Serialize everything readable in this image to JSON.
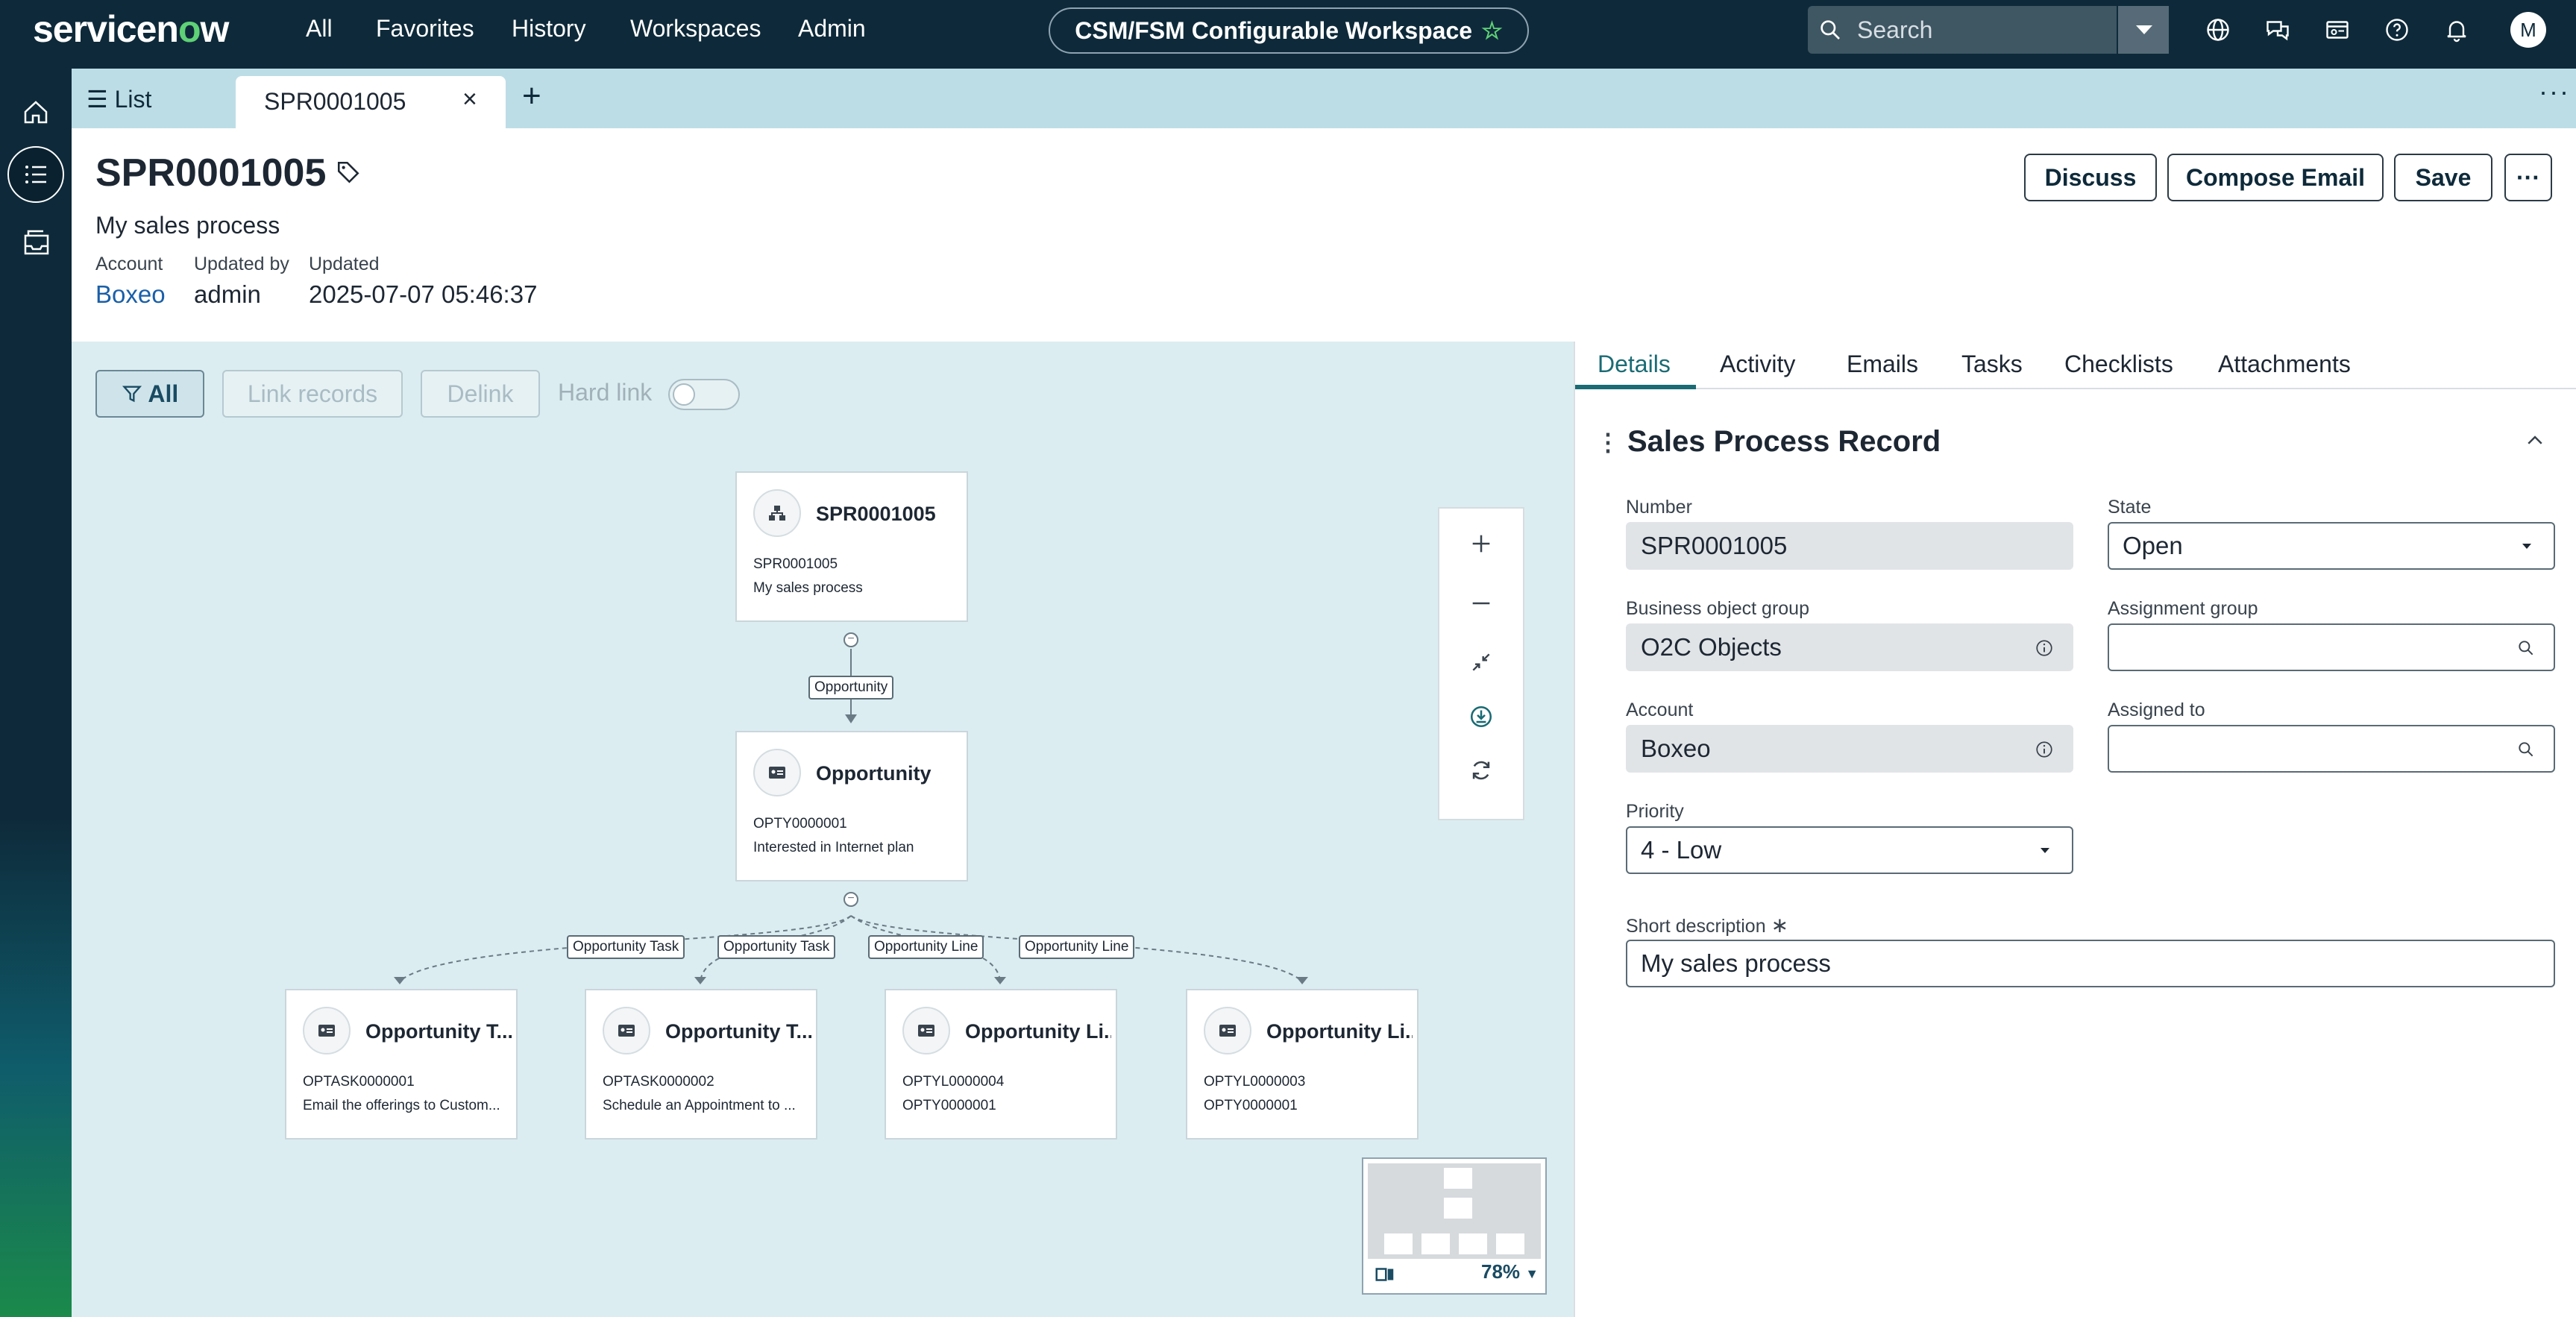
{
  "topbar": {
    "logo_prefix": "servicen",
    "logo_o": "o",
    "logo_suffix": "w",
    "nav": [
      "All",
      "Favorites",
      "History",
      "Workspaces",
      "Admin"
    ],
    "workspace": "CSM/FSM Configurable Workspace",
    "search_placeholder": "Search",
    "avatar_initial": "M"
  },
  "tabs": {
    "list_label": "List",
    "active_label": "SPR0001005",
    "close_glyph": "×",
    "add_glyph": "+",
    "more_glyph": "···"
  },
  "record": {
    "title": "SPR0001005",
    "subtitle": "My sales process",
    "fields": [
      {
        "label": "Account",
        "value": "Boxeo"
      },
      {
        "label": "Updated by",
        "value": "admin"
      },
      {
        "label": "Updated",
        "value": "2025-07-07 05:46:37"
      }
    ],
    "buttons": {
      "discuss": "Discuss",
      "compose": "Compose Email",
      "save": "Save",
      "more": "···"
    }
  },
  "canvas": {
    "filter_all": "All",
    "link_records": "Link records",
    "delink": "Delink",
    "hard_link": "Hard link",
    "root": {
      "title": "SPR0001005",
      "line1": "SPR0001005",
      "line2": "My sales process"
    },
    "mid_edge": "Opportunity",
    "mid": {
      "title": "Opportunity",
      "line1": "OPTY0000001",
      "line2": "Interested in Internet plan"
    },
    "edges": [
      "Opportunity Task",
      "Opportunity Task",
      "Opportunity Line",
      "Opportunity Line"
    ],
    "children": [
      {
        "title": "Opportunity T...",
        "line1": "OPTASK0000001",
        "line2": "Email the offerings to Custom..."
      },
      {
        "title": "Opportunity T...",
        "line1": "OPTASK0000002",
        "line2": "Schedule an Appointment to ..."
      },
      {
        "title": "Opportunity Li...",
        "line1": "OPTYL0000004",
        "line2": "OPTY0000001"
      },
      {
        "title": "Opportunity Li...",
        "line1": "OPTYL0000003",
        "line2": "OPTY0000001"
      }
    ],
    "minimap_zoom": "78%"
  },
  "panel": {
    "tabs": [
      "Details",
      "Activity",
      "Emails",
      "Tasks",
      "Checklists",
      "Attachments"
    ],
    "section_title": "Sales Process Record",
    "number_label": "Number",
    "number_value": "SPR0001005",
    "state_label": "State",
    "state_value": "Open",
    "bog_label": "Business object group",
    "bog_value": "O2C Objects",
    "assign_group_label": "Assignment group",
    "assign_group_value": "",
    "account_label": "Account",
    "account_value": "Boxeo",
    "assigned_to_label": "Assigned to",
    "assigned_to_value": "",
    "priority_label": "Priority",
    "priority_value": "4 - Low",
    "short_desc_label": "Short description",
    "short_desc_value": "My sales process"
  },
  "colors": {
    "topbar": "#0e2a3a",
    "brand_green": "#5fd176",
    "tabs_bar": "#bcdde6",
    "canvas_bg": "#dcedf1",
    "accent": "#1a6b74",
    "link": "#1a5fa8"
  }
}
